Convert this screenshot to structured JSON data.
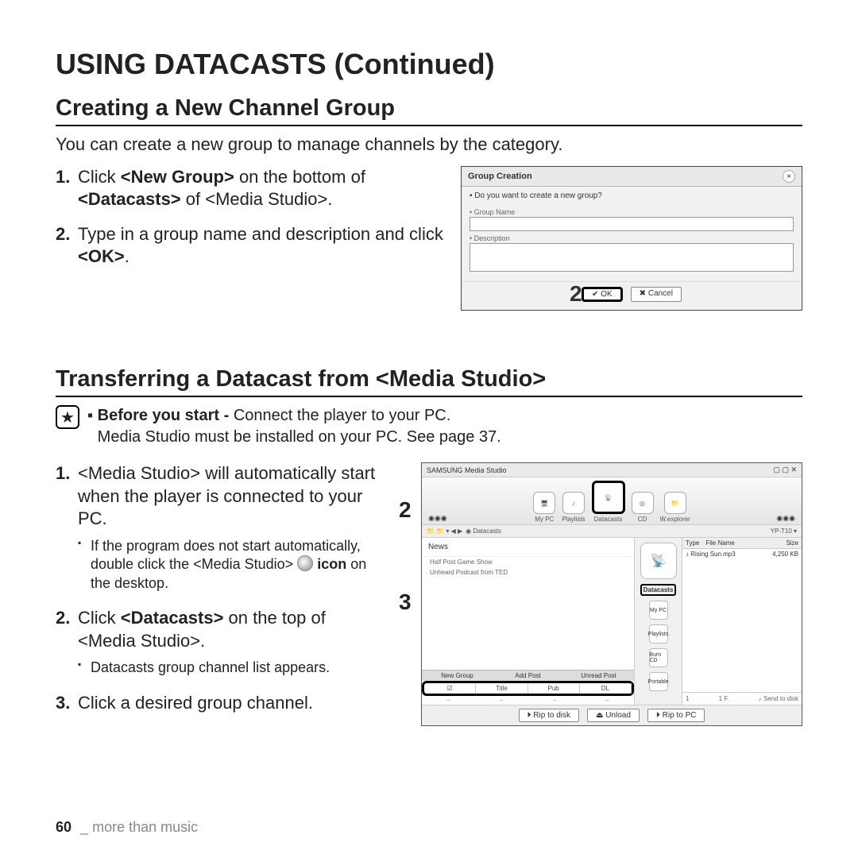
{
  "page_title": "USING DATACASTS (Continued)",
  "section1": {
    "heading": "Creating a New Channel Group",
    "intro": "You can create a new group to manage channels by the category.",
    "step1_pre": "Click ",
    "step1_bold1": "<New Group>",
    "step1_mid": " on the bottom of ",
    "step1_bold2": "<Datacasts>",
    "step1_post": " of <Media Studio>.",
    "step2_pre": "Type in a group name and description and click ",
    "step2_bold": "<OK>",
    "step2_post": "."
  },
  "dialog": {
    "title": "Group Creation",
    "msg": "• Do you want to create a new group?",
    "label_name": "• Group Name",
    "label_desc": "• Description",
    "ok": "✔ OK",
    "cancel": "✖ Cancel",
    "callout": "2"
  },
  "section2": {
    "heading": "Transferring a Datacast from <Media Studio>",
    "star_bold": "Before you start - ",
    "star_line1": "Connect the player to your PC.",
    "star_line2": "Media Studio must be installed on your PC. See page 37.",
    "step1": "<Media Studio> will automatically start when the player is connected to your PC.",
    "step1_bullet_pre": "If the program does not start automatically, double click the <Media Studio> ",
    "step1_bullet_bold": "icon",
    "step1_bullet_post": " on the desktop.",
    "step2_pre": "Click ",
    "step2_bold": "<Datacasts>",
    "step2_post": " on the top of <Media Studio>.",
    "step2_bullet": "Datacasts group channel list appears.",
    "step3": "Click a desired group channel."
  },
  "mediastudio": {
    "title": "SAMSUNG Media Studio",
    "tabs": {
      "mypc": "My PC",
      "playlists": "Playlists",
      "datacasts": "Datacasts",
      "cd": "CD",
      "explorer": "W.explorer"
    },
    "breadcrumb": "◉ Datacasts",
    "list_header": "News",
    "feed1": "Half Post Game Show",
    "feed2": "Unheard Podcast from TED",
    "grid_tabs": [
      "New Group",
      "Add Post",
      "Unread Post"
    ],
    "grid_cols": [
      "☑",
      "Title",
      "Pub",
      "DL"
    ],
    "sidebar_label": "Datacasts",
    "right_tabs": [
      "My PC",
      "Playlists",
      "Burn CD",
      "Portable"
    ],
    "right_cols": [
      "Type",
      "File Name",
      "Size"
    ],
    "right_row": [
      "♪",
      "Rising Sun.mp3",
      "4,250 KB"
    ],
    "right_search_label": "YP-T10 ▾",
    "right_bottom": [
      "1",
      "1 F.",
      "♪ Send to disk"
    ],
    "footer_btns": [
      "⏵ Rip to disk",
      "⏏ Unload",
      "⏵ Rip to PC"
    ],
    "callout2": "2",
    "callout3": "3"
  },
  "footer": {
    "page": "60",
    "divider": "_",
    "chapter": "more than music"
  }
}
